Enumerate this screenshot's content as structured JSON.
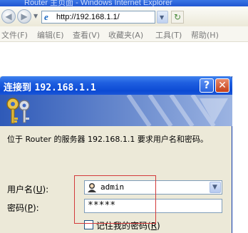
{
  "browser": {
    "window_title": "Router 主页面 - Windows Internet Explorer",
    "address": "http://192.168.1.1/",
    "menu": [
      "文件(F)",
      "编辑(E)",
      "查看(V)",
      "收藏夹(A)",
      "工具(T)",
      "帮助(H)"
    ]
  },
  "dialog": {
    "title_prefix": "连接到",
    "title_host": "192.168.1.1",
    "help_label": "?",
    "close_label": "✕",
    "message": "位于 Router 的服务器 192.168.1.1 要求用户名和密码。",
    "username_label": "用户名",
    "username_key": "U",
    "password_label": "密码",
    "password_key": "P",
    "username_value": "admin",
    "password_value": "*****",
    "remember_label": "记住我的密码",
    "remember_key": "R",
    "remember_checked": false
  },
  "icons": {
    "back": "back-arrow-icon",
    "forward": "forward-arrow-icon",
    "page": "ie-page-icon",
    "keys": "keys-icon",
    "user": "user-avatar-icon"
  },
  "colors": {
    "titlebar": "#0c4ad4",
    "highlight": "#d33a3a",
    "dialog_bg": "#ece9d8"
  }
}
